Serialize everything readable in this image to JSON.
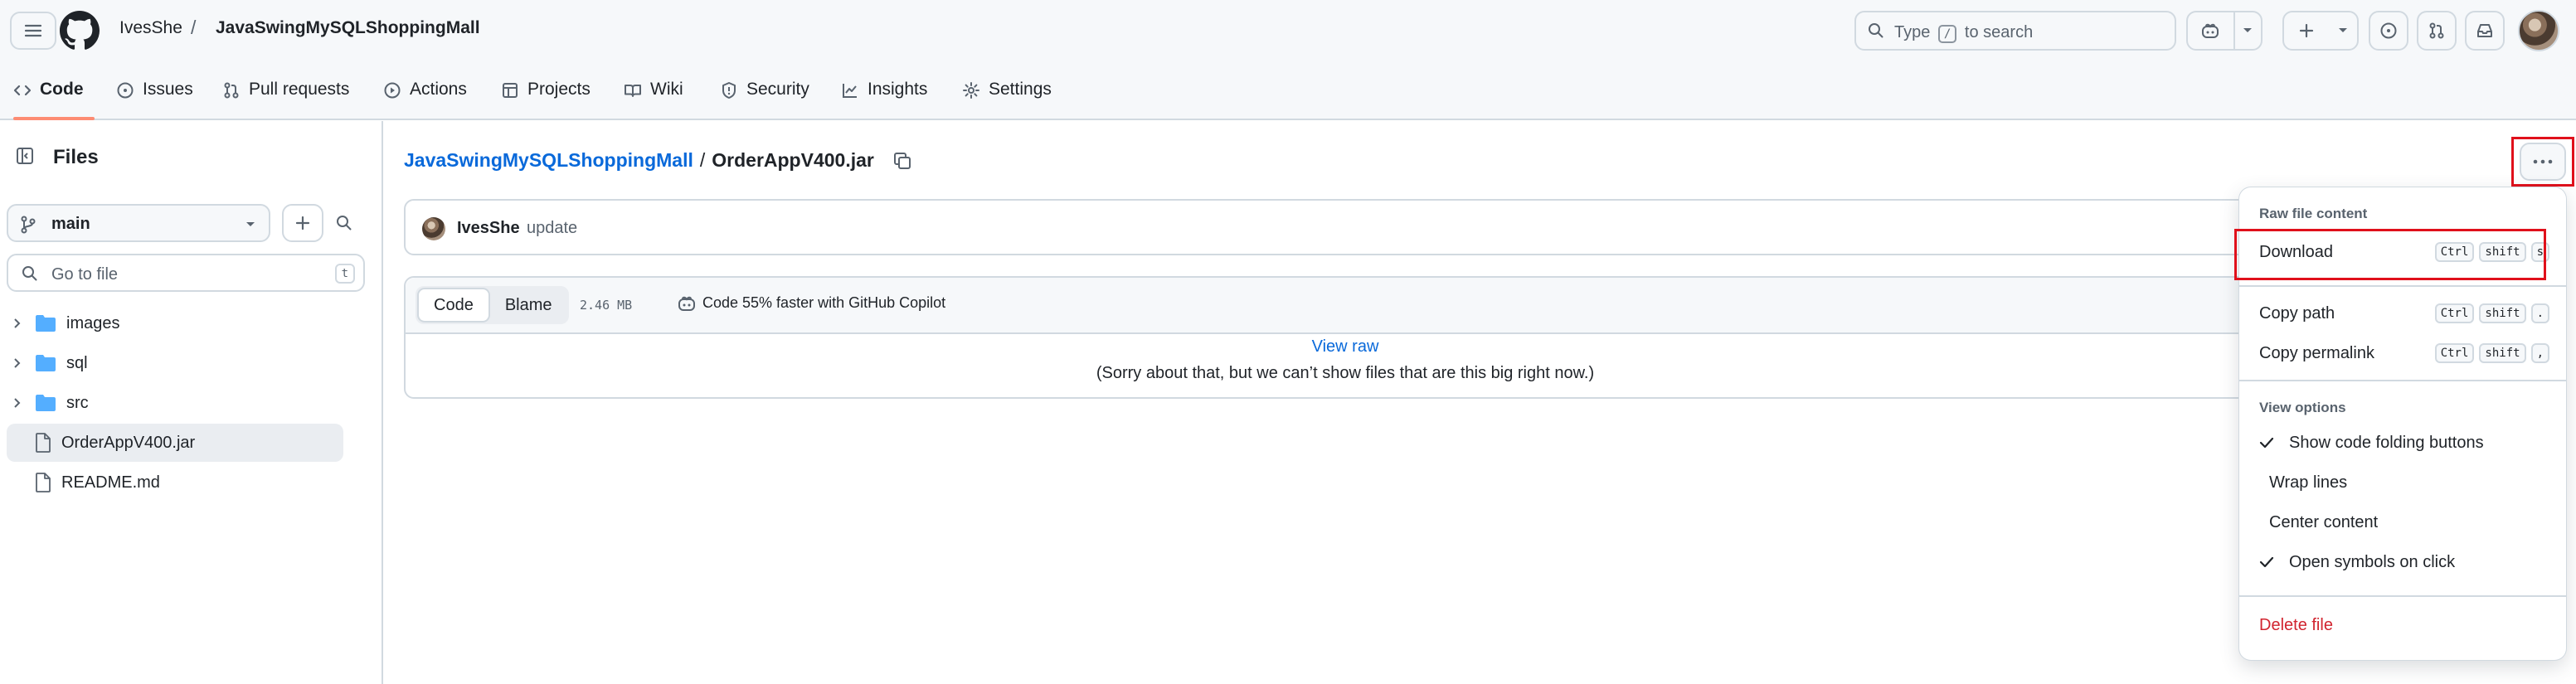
{
  "header": {
    "owner": "IvesShe",
    "separator": "/",
    "repo": "JavaSwingMySQLShoppingMall",
    "search": {
      "prefix": "Type",
      "key": "/",
      "suffix": "to search"
    },
    "icons": [
      "menu-icon",
      "github-logo",
      "search-icon",
      "copilot-icon",
      "plus-icon",
      "issues-icon",
      "pull-request-icon",
      "inbox-icon",
      "avatar"
    ]
  },
  "tabs": [
    {
      "label": "Code",
      "icon": "code-icon",
      "active": true
    },
    {
      "label": "Issues",
      "icon": "issue-icon"
    },
    {
      "label": "Pull requests",
      "icon": "pull-request-icon"
    },
    {
      "label": "Actions",
      "icon": "play-icon"
    },
    {
      "label": "Projects",
      "icon": "table-icon"
    },
    {
      "label": "Wiki",
      "icon": "book-icon"
    },
    {
      "label": "Security",
      "icon": "shield-icon"
    },
    {
      "label": "Insights",
      "icon": "graph-icon"
    },
    {
      "label": "Settings",
      "icon": "gear-icon"
    }
  ],
  "sidebar": {
    "title": "Files",
    "branch": "main",
    "goto_placeholder": "Go to file",
    "goto_key": "t",
    "tree": [
      {
        "name": "images",
        "type": "folder"
      },
      {
        "name": "sql",
        "type": "folder"
      },
      {
        "name": "src",
        "type": "folder"
      },
      {
        "name": "OrderAppV400.jar",
        "type": "file",
        "selected": true
      },
      {
        "name": "README.md",
        "type": "file"
      }
    ]
  },
  "main": {
    "repo_link": "JavaSwingMySQLShoppingMall",
    "slash": "/",
    "file_name": "OrderAppV400.jar",
    "commit": {
      "author": "IvesShe",
      "message": "update"
    },
    "view_tabs": [
      "Code",
      "Blame"
    ],
    "file_size": "2.46 MB",
    "copilot_text": "Code 55% faster with GitHub Copilot",
    "view_raw": "View raw",
    "too_big": "(Sorry about that, but we can’t show files that are this big right now.)"
  },
  "menu": {
    "raw_title": "Raw file content",
    "download": {
      "label": "Download",
      "keys": [
        "Ctrl",
        "shift",
        "s"
      ]
    },
    "copy_path": {
      "label": "Copy path",
      "keys": [
        "Ctrl",
        "shift",
        "."
      ]
    },
    "copy_permalink": {
      "label": "Copy permalink",
      "keys": [
        "Ctrl",
        "shift",
        ","
      ]
    },
    "view_title": "View options",
    "show_folding": "Show code folding buttons",
    "wrap_lines": "Wrap lines",
    "center_content": "Center content",
    "open_symbols": "Open symbols on click",
    "delete_file": "Delete file"
  },
  "colors": {
    "accent": "#0969da",
    "tab_underline": "#fd8c73",
    "highlight": "#e0101b",
    "danger": "#d1242f",
    "folder": "#54aeff"
  }
}
